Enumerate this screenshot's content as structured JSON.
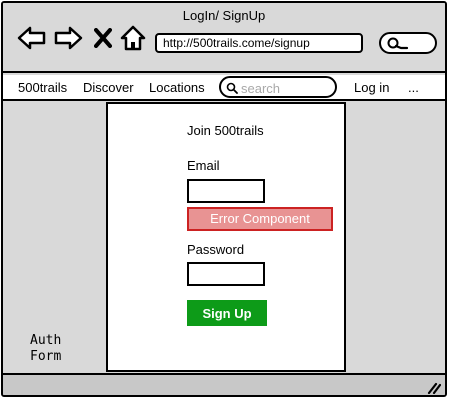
{
  "window": {
    "title": "LogIn/ SignUp"
  },
  "browser": {
    "url": "http://500trails.come/signup",
    "icons": [
      "back-arrow-icon",
      "forward-arrow-icon",
      "close-x-icon",
      "home-icon",
      "search-icon"
    ]
  },
  "menu": {
    "items": [
      "500trails",
      "Discover",
      "Locations"
    ],
    "search_placeholder": "search",
    "login": "Log in",
    "more": "..."
  },
  "form": {
    "title": "Join 500trails",
    "email_label": "Email",
    "error_text": "Error Component",
    "password_label": "Password",
    "signup_label": "Sign Up"
  },
  "annotation": {
    "line1": "Auth",
    "line2": "Form"
  },
  "colors": {
    "chrome": "#d9d9d9",
    "error_fill": "#e89393",
    "error_border": "#cc2222",
    "button_green": "#0d9b18"
  }
}
